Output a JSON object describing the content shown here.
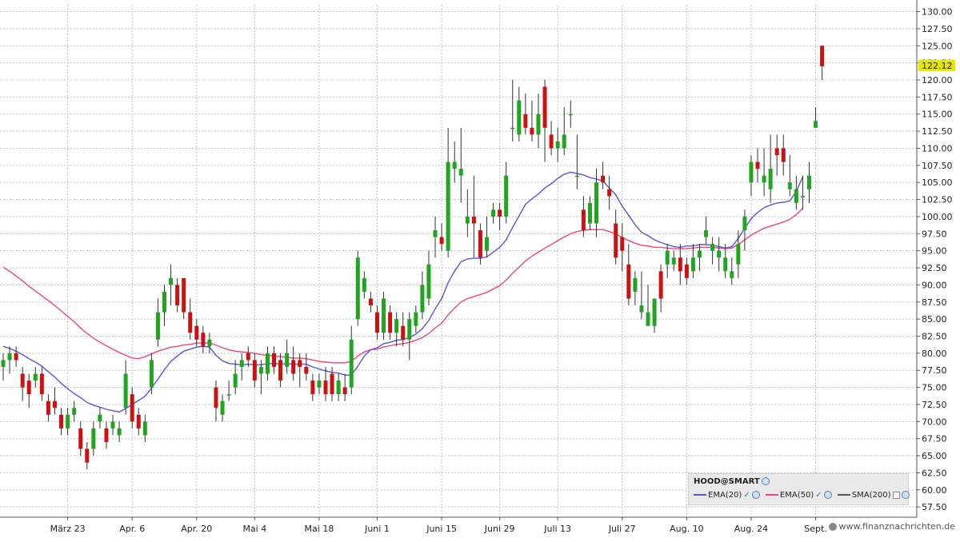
{
  "chart_data": {
    "type": "candlestick",
    "title": "",
    "xlabel": "",
    "ylabel": "",
    "ylim": [
      56,
      131
    ],
    "y_ticks": [
      "57.50",
      "60.00",
      "62.50",
      "65.00",
      "67.50",
      "70.00",
      "72.50",
      "75.00",
      "77.50",
      "80.00",
      "82.50",
      "85.00",
      "87.50",
      "90.00",
      "92.50",
      "95.00",
      "97.50",
      "100.00",
      "102.50",
      "105.00",
      "107.50",
      "110.00",
      "112.50",
      "115.00",
      "117.50",
      "120.00",
      "122.50",
      "125.00",
      "127.50",
      "130.00"
    ],
    "x_ticks": [
      {
        "label": "März 23",
        "index": 10
      },
      {
        "label": "Apr. 6",
        "index": 20
      },
      {
        "label": "Apr. 20",
        "index": 30
      },
      {
        "label": "Mai 4",
        "index": 39
      },
      {
        "label": "Mai 18",
        "index": 49
      },
      {
        "label": "Juni 1",
        "index": 58
      },
      {
        "label": "Juni 15",
        "index": 68
      },
      {
        "label": "Juni 29",
        "index": 77
      },
      {
        "label": "Juli 13",
        "index": 86
      },
      {
        "label": "Juli 27",
        "index": 96
      },
      {
        "label": "Aug. 10",
        "index": 106
      },
      {
        "label": "Aug. 24",
        "index": 116
      },
      {
        "label": "Sept.",
        "index": 126
      }
    ],
    "last_price": "122.12",
    "colors": {
      "up": "#1fa51f",
      "down": "#cc1111",
      "ema20": "#5555dd",
      "ema50": "#ee4477",
      "grid": "#bfbfbf",
      "last_price_bg": "#e6e600"
    },
    "candles": [
      [
        78,
        80,
        76,
        79
      ],
      [
        79,
        81,
        77,
        80
      ],
      [
        80,
        81,
        78,
        79
      ],
      [
        77,
        78,
        73,
        75
      ],
      [
        76,
        77,
        72,
        74
      ],
      [
        76,
        78,
        75,
        77
      ],
      [
        77,
        78,
        73,
        74
      ],
      [
        73,
        74,
        70,
        71
      ],
      [
        73,
        75,
        71,
        72
      ],
      [
        71,
        72,
        68,
        69
      ],
      [
        69,
        72,
        68,
        71
      ],
      [
        71,
        73,
        70,
        72
      ],
      [
        69,
        70,
        65,
        66
      ],
      [
        66,
        67,
        63,
        64
      ],
      [
        66,
        70,
        65,
        69
      ],
      [
        70,
        72,
        69,
        71
      ],
      [
        69,
        70,
        66,
        67
      ],
      [
        69,
        71,
        68,
        70
      ],
      [
        68,
        70,
        67,
        69
      ],
      [
        72,
        79,
        71,
        77
      ],
      [
        74,
        75,
        69,
        70
      ],
      [
        71,
        72,
        68,
        69
      ],
      [
        68,
        71,
        67,
        70
      ],
      [
        75,
        80,
        74,
        79
      ],
      [
        82,
        88,
        81,
        86
      ],
      [
        86,
        90,
        84,
        89
      ],
      [
        90,
        93,
        87,
        91
      ],
      [
        90,
        91,
        86,
        87
      ],
      [
        91,
        91,
        85,
        86
      ],
      [
        86,
        88,
        82,
        83
      ],
      [
        84,
        85,
        81,
        82
      ],
      [
        83,
        84,
        80,
        81
      ],
      [
        81,
        83,
        80,
        82
      ],
      [
        75,
        76,
        70,
        72
      ],
      [
        71,
        74,
        70,
        73
      ],
      [
        74,
        76,
        73,
        74
      ],
      [
        75,
        79,
        74,
        77
      ],
      [
        78,
        80,
        76,
        79
      ],
      [
        80,
        81,
        78,
        79
      ],
      [
        79,
        80,
        75,
        76
      ],
      [
        77,
        79,
        74,
        78
      ],
      [
        77,
        81,
        76,
        80
      ],
      [
        80,
        81,
        77,
        78
      ],
      [
        79,
        80,
        75,
        76
      ],
      [
        78,
        82,
        77,
        80
      ],
      [
        79,
        81,
        76,
        77
      ],
      [
        79,
        80,
        75,
        78
      ],
      [
        78,
        80,
        76,
        77
      ],
      [
        76,
        77,
        73,
        74
      ],
      [
        75,
        77,
        74,
        76
      ],
      [
        76,
        78,
        73,
        74
      ],
      [
        77,
        78,
        73,
        74
      ],
      [
        74,
        77,
        73,
        76
      ],
      [
        75,
        77,
        73,
        74
      ],
      [
        75,
        84,
        74,
        82
      ],
      [
        85,
        95,
        84,
        94
      ],
      [
        89,
        92,
        88,
        91
      ],
      [
        88,
        89,
        86,
        87
      ],
      [
        86,
        87,
        82,
        83
      ],
      [
        83,
        89,
        82,
        88
      ],
      [
        86,
        87,
        82,
        83
      ],
      [
        83,
        86,
        81,
        85
      ],
      [
        84,
        86,
        81,
        82
      ],
      [
        82,
        86,
        79,
        85
      ],
      [
        84,
        87,
        83,
        86
      ],
      [
        86,
        92,
        85,
        90
      ],
      [
        88,
        95,
        87,
        93
      ],
      [
        97,
        100,
        94,
        98
      ],
      [
        97,
        99,
        95,
        96
      ],
      [
        95,
        113,
        94,
        108
      ],
      [
        107,
        111,
        105,
        108
      ],
      [
        106,
        113,
        102,
        107
      ],
      [
        99,
        104,
        97,
        100
      ],
      [
        100,
        106,
        94,
        99
      ],
      [
        98,
        99,
        93,
        94
      ],
      [
        95,
        100,
        94,
        97
      ],
      [
        100,
        102,
        99,
        101
      ],
      [
        101,
        102,
        98,
        100
      ],
      [
        100,
        108,
        99,
        106
      ],
      [
        113,
        120,
        111,
        113
      ],
      [
        112,
        119,
        111,
        117
      ],
      [
        115,
        118,
        112,
        113
      ],
      [
        113,
        117,
        111,
        112
      ],
      [
        112,
        118,
        110,
        115
      ],
      [
        119,
        120,
        108,
        113
      ],
      [
        112,
        114,
        109,
        110
      ],
      [
        110,
        113,
        108,
        111
      ],
      [
        110,
        116,
        109,
        112
      ],
      [
        115,
        117,
        113,
        115
      ],
      [
        106,
        112,
        104,
        106
      ],
      [
        101,
        103,
        97,
        98
      ],
      [
        99,
        103,
        98,
        102
      ],
      [
        99,
        107,
        97,
        105
      ],
      [
        106,
        108,
        104,
        105
      ],
      [
        104,
        106,
        101,
        103
      ],
      [
        99,
        101,
        93,
        94
      ],
      [
        97,
        99,
        92,
        95
      ],
      [
        93,
        96,
        87,
        88
      ],
      [
        89,
        92,
        87,
        91
      ],
      [
        86,
        92,
        85,
        87
      ],
      [
        84,
        90,
        84,
        86
      ],
      [
        84,
        88,
        83,
        88
      ],
      [
        92,
        93,
        86,
        88
      ],
      [
        93,
        96,
        91,
        95
      ],
      [
        93,
        95,
        92,
        94
      ],
      [
        94,
        96,
        90,
        92
      ],
      [
        93,
        94,
        90,
        91
      ],
      [
        92,
        96,
        91,
        94
      ],
      [
        94,
        96,
        92,
        95
      ],
      [
        97,
        100,
        96,
        98
      ],
      [
        95,
        97,
        93,
        96
      ],
      [
        94,
        97,
        92,
        95
      ],
      [
        92,
        96,
        91,
        94
      ],
      [
        91,
        94,
        90,
        92
      ],
      [
        93,
        98,
        91,
        96
      ],
      [
        98,
        101,
        95,
        100
      ],
      [
        105,
        109,
        103,
        108
      ],
      [
        108,
        110,
        105,
        107
      ],
      [
        105,
        110,
        103,
        106
      ],
      [
        104,
        112,
        102,
        107
      ],
      [
        110,
        112,
        106,
        109
      ],
      [
        110,
        112,
        106,
        108
      ],
      [
        104,
        109,
        103,
        105
      ],
      [
        102,
        106,
        101,
        104
      ],
      [
        103,
        106,
        101,
        103
      ],
      [
        104,
        108,
        102,
        106
      ],
      [
        113,
        116,
        113,
        114
      ],
      [
        125,
        125,
        120,
        122
      ]
    ],
    "series": [
      {
        "name": "EMA(20)",
        "values": [
          81,
          80.7,
          80.3,
          79.8,
          79.2,
          78.7,
          78.1,
          77.3,
          76.5,
          75.6,
          74.8,
          74.1,
          73.5,
          72.8,
          72.4,
          72.1,
          71.8,
          71.6,
          71.4,
          71.9,
          72.5,
          73.1,
          73.7,
          74.9,
          76.2,
          77.6,
          78.8,
          79.6,
          80.3,
          80.6,
          80.9,
          81.0,
          80.9,
          79.7,
          78.9,
          78.5,
          78.4,
          78.3,
          78.4,
          78.3,
          78.3,
          78.5,
          78.5,
          78.4,
          78.5,
          78.4,
          78.4,
          78.4,
          78.0,
          77.7,
          77.4,
          77.2,
          77.1,
          76.8,
          76.8,
          78.1,
          79.6,
          80.5,
          80.8,
          81.4,
          81.6,
          81.9,
          82.0,
          82.3,
          82.8,
          83.6,
          84.8,
          86.5,
          88.0,
          90.3,
          92.0,
          93.4,
          93.8,
          93.9,
          93.9,
          94.1,
          94.8,
          95.5,
          96.6,
          98.4,
          100.1,
          101.8,
          102.6,
          103.3,
          104.2,
          104.8,
          105.6,
          106.2,
          106.5,
          106.3,
          106.1,
          105.7,
          105.5,
          105.2,
          104.2,
          103.2,
          101.5,
          100.2,
          98.8,
          97.7,
          97.2,
          96.6,
          96.2,
          95.9,
          95.6,
          95.5,
          95.7,
          95.7,
          95.9,
          95.9,
          95.8,
          95.6,
          95.4,
          95.6,
          96.8,
          98.3,
          99.7,
          100.6,
          101.3,
          101.7,
          102.0,
          102.1,
          102.3,
          103.7,
          105.8
        ]
      },
      {
        "name": "EMA(50)",
        "values": [
          92.6,
          92.0,
          91.3,
          90.6,
          89.8,
          89.1,
          88.4,
          87.7,
          87.0,
          86.2,
          85.4,
          84.6,
          83.7,
          82.9,
          82.2,
          81.6,
          81.1,
          80.6,
          80.1,
          79.7,
          79.3,
          79.2,
          79.5,
          79.9,
          80.3,
          80.6,
          80.9,
          81.0,
          81.2,
          81.3,
          81.5,
          81.5,
          81.5,
          81.2,
          80.8,
          80.5,
          80.3,
          80.2,
          80.1,
          80.0,
          79.8,
          79.7,
          79.6,
          79.5,
          79.4,
          79.3,
          79.3,
          79.2,
          79.0,
          78.8,
          78.7,
          78.6,
          78.6,
          78.6,
          78.8,
          79.6,
          80.2,
          80.5,
          80.6,
          80.9,
          81.1,
          81.3,
          81.4,
          81.6,
          81.9,
          82.3,
          82.9,
          83.7,
          84.4,
          85.6,
          86.6,
          87.5,
          88.0,
          88.3,
          88.6,
          88.9,
          89.4,
          89.9,
          90.7,
          91.7,
          92.6,
          93.5,
          94.2,
          94.8,
          95.4,
          95.9,
          96.5,
          97.0,
          97.5,
          97.8,
          98.0,
          98.1,
          98.1,
          98.1,
          97.8,
          97.5,
          96.9,
          96.5,
          96.1,
          95.8,
          95.7,
          95.5,
          95.5,
          95.4,
          95.3,
          95.3,
          95.3,
          95.4,
          95.5,
          95.5,
          95.5,
          95.4,
          95.3,
          95.4,
          95.9,
          96.6,
          97.3,
          97.8,
          98.3,
          98.6,
          98.9,
          99.2,
          99.6,
          100.3,
          101.2
        ]
      }
    ],
    "legend": {
      "title": "HOOD@SMART",
      "items": [
        {
          "name": "EMA(20)",
          "color": "#5555dd"
        },
        {
          "name": "EMA(50)",
          "color": "#ee4477"
        },
        {
          "name": "SMA(200)",
          "color": "#555555"
        }
      ]
    },
    "watermark": "www.finanznachrichten.de"
  }
}
